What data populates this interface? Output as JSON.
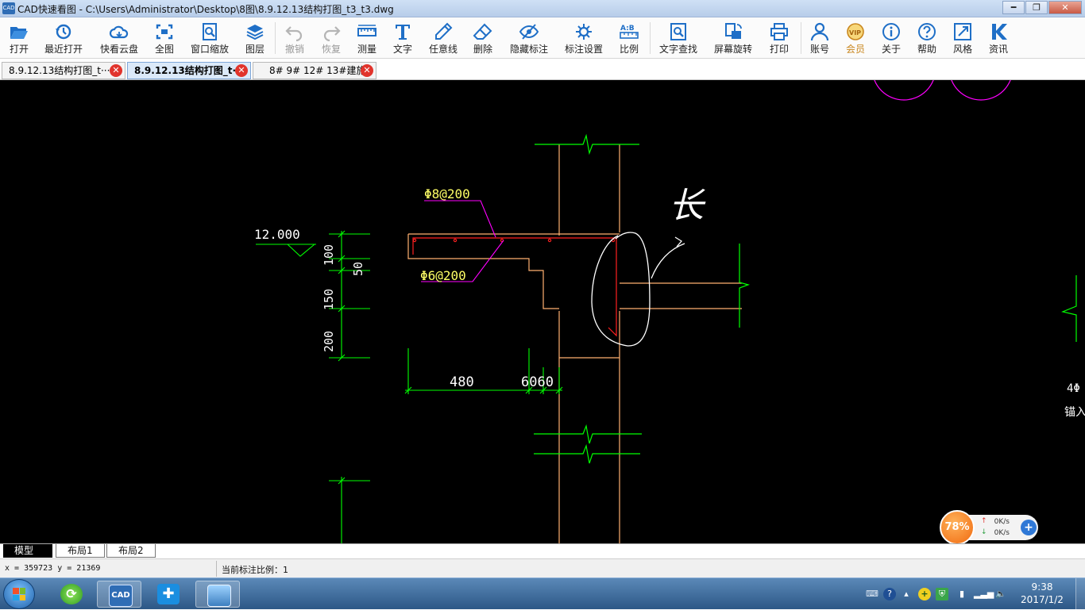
{
  "window": {
    "title": "CAD快速看图 - C:\\Users\\Administrator\\Desktop\\8图\\8.9.12.13结构打图_t3_t3.dwg",
    "app_icon_text": "CAD",
    "min": "━",
    "max": "❐",
    "close": "✕"
  },
  "toolbar": {
    "items": [
      {
        "id": "open",
        "label": "打开",
        "icon": "folder-open-icon"
      },
      {
        "id": "recent",
        "label": "最近打开",
        "icon": "history-icon"
      },
      {
        "id": "cloud",
        "label": "快看云盘",
        "icon": "cloud-icon"
      },
      {
        "id": "fit",
        "label": "全图",
        "icon": "fit-view-icon"
      },
      {
        "id": "zoom",
        "label": "窗口缩放",
        "icon": "zoom-window-icon"
      },
      {
        "id": "layers",
        "label": "图层",
        "icon": "layers-icon"
      },
      {
        "id": "undo",
        "label": "撤销",
        "icon": "undo-icon",
        "disabled": true
      },
      {
        "id": "redo",
        "label": "恢复",
        "icon": "redo-icon",
        "disabled": true
      },
      {
        "id": "measure",
        "label": "测量",
        "icon": "ruler-icon"
      },
      {
        "id": "text",
        "label": "文字",
        "icon": "text-icon"
      },
      {
        "id": "freeline",
        "label": "任意线",
        "icon": "pencil-icon"
      },
      {
        "id": "erase",
        "label": "删除",
        "icon": "eraser-icon"
      },
      {
        "id": "hide",
        "label": "隐藏标注",
        "icon": "eye-hide-icon"
      },
      {
        "id": "dimset",
        "label": "标注设置",
        "icon": "dimension-settings-icon"
      },
      {
        "id": "scale",
        "label": "比例",
        "icon": "scale-icon"
      },
      {
        "id": "find",
        "label": "文字查找",
        "icon": "text-search-icon"
      },
      {
        "id": "rotate",
        "label": "屏幕旋转",
        "icon": "rotate-screen-icon"
      },
      {
        "id": "print",
        "label": "打印",
        "icon": "printer-icon"
      },
      {
        "id": "account",
        "label": "账号",
        "icon": "user-icon"
      },
      {
        "id": "vip",
        "label": "会员",
        "icon": "vip-icon",
        "vip": true
      },
      {
        "id": "about",
        "label": "关于",
        "icon": "info-icon"
      },
      {
        "id": "help",
        "label": "帮助",
        "icon": "help-icon"
      },
      {
        "id": "style",
        "label": "风格",
        "icon": "style-icon"
      },
      {
        "id": "news",
        "label": "资讯",
        "icon": "news-icon"
      }
    ]
  },
  "tabs": [
    {
      "label": "8.9.12.13结构打图_t···",
      "active": false
    },
    {
      "label": "8.9.12.13结构打图_t·",
      "active": true
    },
    {
      "label": "8# 9# 12# 13#建施",
      "active": false
    }
  ],
  "drawing": {
    "elevation": "12.000",
    "rebar_top": "Φ8@200",
    "rebar_bottom": "Φ6@200",
    "dim_100": "100",
    "dim_50": "50",
    "dim_150": "150",
    "dim_200": "200",
    "dim_480": "480",
    "dim_6060": "6060",
    "handwritten": "长",
    "edge_text_1": "4Φ",
    "edge_text_2": "锚入"
  },
  "layout_tabs": [
    {
      "label": "模型",
      "active": true
    },
    {
      "label": "布局1",
      "active": false
    },
    {
      "label": "布局2",
      "active": false
    }
  ],
  "status": {
    "coords": "x = 359723  y = 21369",
    "scale_text": "当前标注比例：1"
  },
  "net_widget": {
    "percent": "78%",
    "up": "0K/s",
    "down": "0K/s"
  },
  "taskbar": {
    "cad_label": "CAD",
    "time": "9:38",
    "date": "2017/1/2"
  },
  "colors": {
    "cad_green": "#00ff00",
    "cad_orange": "#ffb070",
    "cad_red": "#ff2020",
    "cad_magenta": "#ff00ff",
    "cad_yellow": "#ffff66",
    "sketch_white": "#ffffff"
  }
}
